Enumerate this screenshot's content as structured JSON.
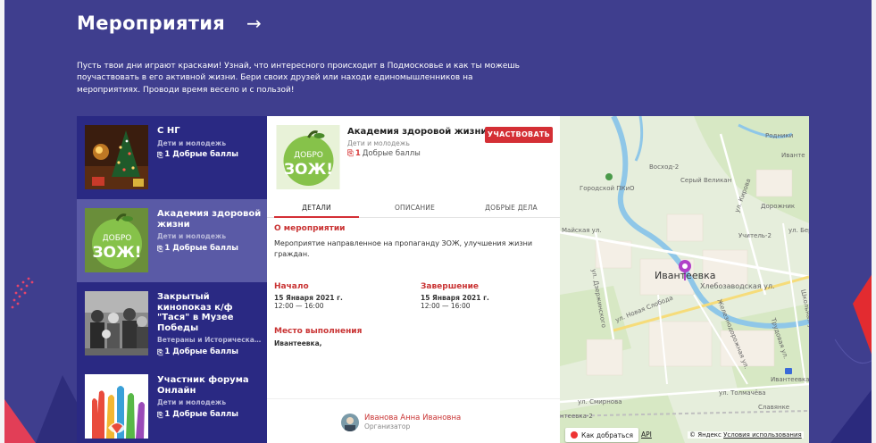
{
  "colors": {
    "background": "#3f3e8e",
    "list_bg": "#2a2983",
    "list_active": "#5a5aa6",
    "accent": "#d42f35"
  },
  "header": {
    "title": "Мероприятия",
    "arrow_icon": "arrow-right-icon",
    "intro": "Пусть твои дни играют красками! Узнай, что интересного происходит в Подмосковье и как ты можешь поучаствовать в его активной жизни. Бери своих друзей или находи единомышленников на мероприятиях. Проводи время весело и с пользой!"
  },
  "events": [
    {
      "title": "С НГ",
      "category": "Дети и молодежь",
      "points": "1 Добрые баллы"
    },
    {
      "title": "Академия здоровой жизни",
      "category": "Дети и молодежь",
      "points": "1 Добрые баллы"
    },
    {
      "title": "Закрытый кинопоказ к/ф \"Тася\" в Музее Победы",
      "category": "Ветераны и Историческая п...",
      "points": "1 Добрые баллы"
    },
    {
      "title": "Участник форума Онлайн",
      "category": "Дети и молодежь",
      "points": "1 Добрые баллы"
    }
  ],
  "detail": {
    "title": "Академия здоровой жизни",
    "category": "Дети и молодежь",
    "points_num": "1",
    "points_label": "Добрые баллы",
    "join_button": "УЧАСТВОВАТЬ",
    "tabs": [
      "ДЕТАЛИ",
      "ОПИСАНИЕ",
      "ДОБРЫЕ ДЕЛА"
    ],
    "about_title": "О мероприятии",
    "about_text": "Мероприятие направленное на пропаганду ЗОЖ, улучшения жизни граждан.",
    "start_title": "Начало",
    "start_date": "15 Января 2021 г.",
    "start_time": "12:00 — 16:00",
    "end_title": "Завершение",
    "end_date": "15 Января 2021 г.",
    "end_time": "12:00 — 16:00",
    "place_title": "Место выполнения",
    "place_text": "Ивантеевка,",
    "organizer_name": "Иванова Анна Ивановна",
    "organizer_role": "Организатор"
  },
  "map": {
    "city": "Ивантеевка",
    "labels": {
      "park": "Городской ПКиО",
      "vosxod": "Восход-2",
      "seryi": "Серый Великан",
      "rodniki": "Родники",
      "dorojnik": "Дорожник",
      "uchitel": "Учитель-2",
      "maiskaya": "Майская ул.",
      "kirova": "ул. Кирова",
      "bera": "ул. Бер",
      "khleb": "Хлебозаводская ул.",
      "novaya": "ул. Новая Слобода",
      "dzerzh": "ул. Дзержинского",
      "smirnova": "ул. Смирнова",
      "tolmacheva": "ул. Толмачёва",
      "ivanteevka2": "нтеевка-2",
      "ivanteevka_st": "Ивантеевка",
      "shkolnaya": "Школьная ул.",
      "trudovaya": "Трудовая ул.",
      "jd": "Железнодорожная ул.",
      "savinaya": "Славянке",
      "ivanteevka_top": "Иванте"
    },
    "route_button": "Как добраться",
    "api_link": "API",
    "copyright": "© Яндекс",
    "terms": "Условия использования"
  }
}
